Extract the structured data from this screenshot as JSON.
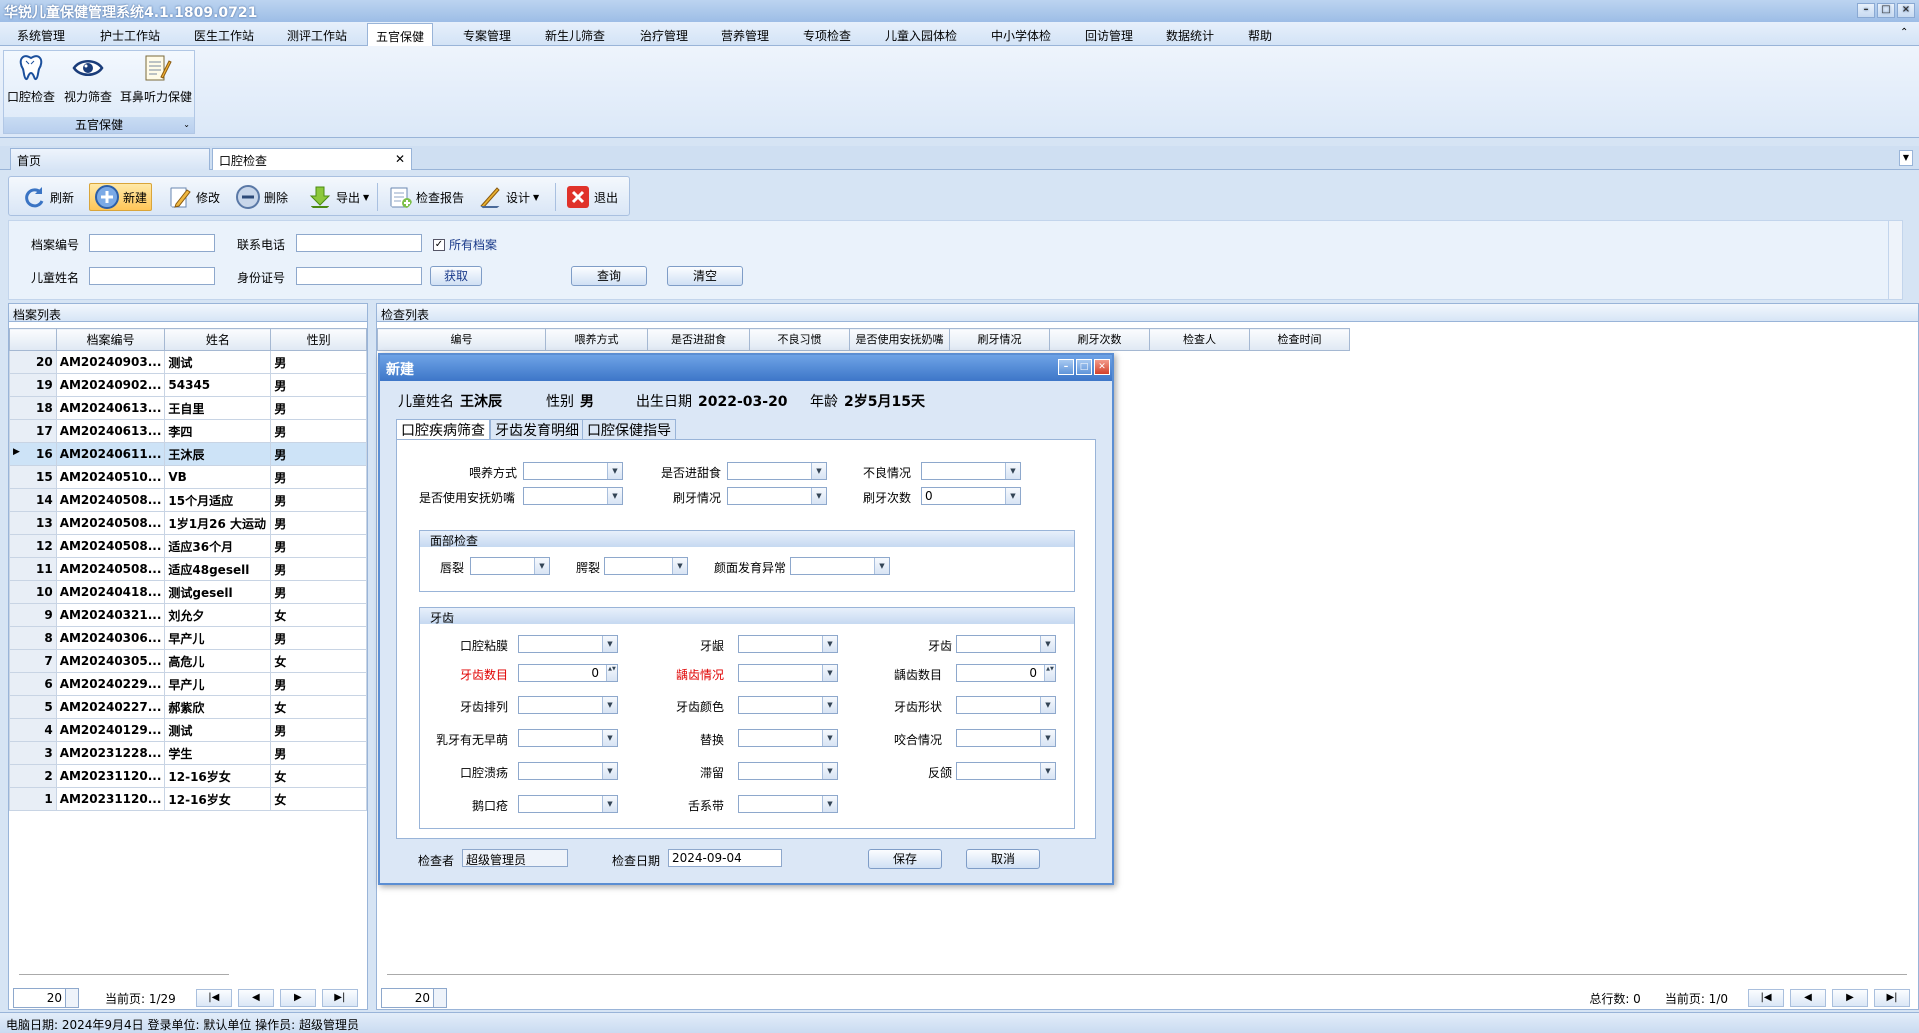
{
  "app": {
    "title": "华锐儿童保健管理系统4.1.1809.0721"
  },
  "menu": [
    "系统管理",
    "护士工作站",
    "医生工作站",
    "测评工作站",
    "五官保健",
    "专案管理",
    "新生儿筛查",
    "治疗管理",
    "营养管理",
    "专项检查",
    "儿童入园体检",
    "中小学体检",
    "回访管理",
    "数据统计",
    "帮助"
  ],
  "menu_active": "五官保健",
  "ribbon": {
    "buttons": [
      {
        "label": "口腔检查",
        "icon": "tooth-icon"
      },
      {
        "label": "视力筛查",
        "icon": "eye-icon"
      },
      {
        "label": "耳鼻听力保健",
        "icon": "notepad-icon"
      }
    ],
    "group_title": "五官保健"
  },
  "doc_tabs": {
    "home": "首页",
    "active": "口腔检查",
    "close": "✕"
  },
  "toolbar": {
    "refresh": "刷新",
    "new": "新建",
    "edit": "修改",
    "delete": "删除",
    "export": "导出",
    "report": "检查报告",
    "design": "设计",
    "exit": "退出"
  },
  "search": {
    "archive_no": "档案编号",
    "phone": "联系电话",
    "all_archives": "所有档案",
    "child_name": "儿童姓名",
    "id_no": "身份证号",
    "fetch": "获取",
    "query": "查询",
    "clear": "清空"
  },
  "archive_list": {
    "title": "档案列表",
    "columns": [
      "档案编号",
      "姓名",
      "性别"
    ],
    "rows": [
      {
        "n": "20",
        "id": "AM20240903...",
        "name": "测试",
        "sex": "男"
      },
      {
        "n": "19",
        "id": "AM20240902...",
        "name": "54345",
        "sex": "男"
      },
      {
        "n": "18",
        "id": "AM20240613...",
        "name": "王自里",
        "sex": "男"
      },
      {
        "n": "17",
        "id": "AM20240613...",
        "name": "李四",
        "sex": "男"
      },
      {
        "n": "16",
        "id": "AM20240611...",
        "name": "王沐辰",
        "sex": "男"
      },
      {
        "n": "15",
        "id": "AM20240510...",
        "name": "VB",
        "sex": "男"
      },
      {
        "n": "14",
        "id": "AM20240508...",
        "name": "15个月适应",
        "sex": "男"
      },
      {
        "n": "13",
        "id": "AM20240508...",
        "name": "1岁1月26 大运动",
        "sex": "男"
      },
      {
        "n": "12",
        "id": "AM20240508...",
        "name": "适应36个月",
        "sex": "男"
      },
      {
        "n": "11",
        "id": "AM20240508...",
        "name": "适应48gesell",
        "sex": "男"
      },
      {
        "n": "10",
        "id": "AM20240418...",
        "name": "测试gesell",
        "sex": "男"
      },
      {
        "n": "9",
        "id": "AM20240321...",
        "name": "刘允夕",
        "sex": "女"
      },
      {
        "n": "8",
        "id": "AM20240306...",
        "name": "早产儿",
        "sex": "男"
      },
      {
        "n": "7",
        "id": "AM20240305...",
        "name": "高危儿",
        "sex": "女"
      },
      {
        "n": "6",
        "id": "AM20240229...",
        "name": "早产儿",
        "sex": "男"
      },
      {
        "n": "5",
        "id": "AM20240227...",
        "name": "郝紫欣",
        "sex": "女"
      },
      {
        "n": "4",
        "id": "AM20240129...",
        "name": "测试",
        "sex": "男"
      },
      {
        "n": "3",
        "id": "AM20231228...",
        "name": "学生",
        "sex": "男"
      },
      {
        "n": "2",
        "id": "AM20231120...",
        "name": "12-16岁女",
        "sex": "女"
      },
      {
        "n": "1",
        "id": "AM20231120...",
        "name": "12-16岁女",
        "sex": "女"
      }
    ],
    "selected_index": 4,
    "page_size": "20",
    "current_page_label": "当前页: 1/29"
  },
  "exam_list": {
    "title": "检查列表",
    "columns": [
      "编号",
      "喂养方式",
      "是否进甜食",
      "不良习惯",
      "是否使用安抚奶嘴",
      "刷牙情况",
      "刷牙次数",
      "检查人",
      "检查时间"
    ],
    "page_size": "20",
    "total_label": "总行数: 0",
    "current_page_label": "当前页: 1/0"
  },
  "dialog": {
    "title": "新建",
    "child_name_label": "儿童姓名",
    "child_name": "王沐辰",
    "sex_label": "性别",
    "sex": "男",
    "birth_label": "出生日期",
    "birth": "2022-03-20",
    "age_label": "年龄",
    "age": "2岁5月15天",
    "tabs": [
      "口腔疾病筛查",
      "牙齿发育明细",
      "口腔保健指导"
    ],
    "fields": {
      "feeding": "喂养方式",
      "sweets": "是否进甜食",
      "bad_habit": "不良情况",
      "pacifier": "是否使用安抚奶嘴",
      "brushing": "刷牙情况",
      "brush_count": "刷牙次数",
      "brush_count_value": "0"
    },
    "face": {
      "title": "面部检查",
      "lip": "唇裂",
      "palate": "腭裂",
      "face_dev": "颜面发育异常"
    },
    "teeth": {
      "title": "牙齿",
      "mucosa": "口腔粘膜",
      "gum": "牙龈",
      "tooth": "牙齿",
      "tooth_count": "牙齿数目",
      "tooth_count_value": "0",
      "caries": "龋齿情况",
      "caries_count": "龋齿数目",
      "caries_count_value": "0",
      "arrange": "牙齿排列",
      "color": "牙齿颜色",
      "shape": "牙齿形状",
      "milk_missing": "乳牙有无早萌",
      "replace": "替换",
      "bite": "咬合情况",
      "ulcer": "口腔溃疡",
      "retain": "滞留",
      "crossbite": "反颌",
      "thrush": "鹅口疮",
      "frenum": "舌系带"
    },
    "examiner_label": "检查者",
    "examiner": "超级管理员",
    "date_label": "检查日期",
    "date": "2024-09-04",
    "save": "保存",
    "cancel": "取消"
  },
  "status": {
    "text": "电脑日期:  2024年9月4日   登录单位:  默认单位   操作员:  超级管理员"
  }
}
